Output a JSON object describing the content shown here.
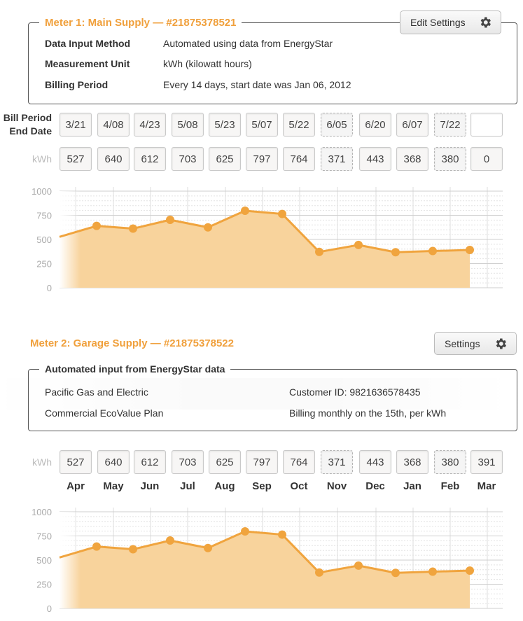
{
  "meter1": {
    "title": "Meter 1: Main Supply — #21875378521",
    "edit_label": "Edit Settings",
    "rows": [
      {
        "label": "Data Input Method",
        "value": "Automated using data from EnergyStar"
      },
      {
        "label": "Measurement Unit",
        "value": "kWh (kilowatt hours)"
      },
      {
        "label": "Billing Period",
        "value": "Every 14 days, start date was Jan 06, 2012"
      }
    ],
    "period_label_line1": "Bill Period",
    "period_label_line2": "End Date",
    "dates": [
      "3/21",
      "4/08",
      "4/23",
      "5/08",
      "5/23",
      "5/07",
      "5/22",
      "6/05",
      "6/20",
      "6/07",
      "7/22",
      ""
    ],
    "kwh_label": "kWh",
    "kwh": [
      "527",
      "640",
      "612",
      "703",
      "625",
      "797",
      "764",
      "371",
      "443",
      "368",
      "380",
      "0"
    ],
    "dashed": [
      7,
      10
    ]
  },
  "meter2": {
    "title": "Meter 2: Garage Supply — #21875378522",
    "settings_label": "Settings",
    "panel_title": "Automated input from EnergyStar data",
    "provider": "Pacific Gas and Electric",
    "plan": "Commercial EcoValue Plan",
    "customer_id": "Customer ID: 9821636578435",
    "billing": "Billing monthly on the 15th, per kWh",
    "kwh_label": "kWh",
    "kwh": [
      "527",
      "640",
      "612",
      "703",
      "625",
      "797",
      "764",
      "371",
      "443",
      "368",
      "380",
      "391"
    ],
    "months": [
      "Apr",
      "May",
      "Jun",
      "Jul",
      "Aug",
      "Sep",
      "Oct",
      "Nov",
      "Dec",
      "Jan",
      "Feb",
      "Mar"
    ],
    "dashed": [
      7,
      10
    ]
  },
  "colors": {
    "accent": "#f0a03c",
    "area_fill": "#f8d39c",
    "line": "#f0a43e"
  },
  "chart_data": [
    {
      "type": "area",
      "x": [
        "3/21",
        "4/08",
        "4/23",
        "5/08",
        "5/23",
        "5/07",
        "5/22",
        "6/05",
        "6/20",
        "6/07",
        "7/22"
      ],
      "series": [
        {
          "values": [
            640,
            612,
            703,
            625,
            797,
            764,
            371,
            443,
            368,
            380,
            391
          ]
        }
      ],
      "lead_in_value": 527,
      "yticks": [
        0,
        250,
        500,
        750,
        1000
      ],
      "ylim": [
        0,
        1000
      ],
      "grid": true
    },
    {
      "type": "area",
      "x": [
        "Apr",
        "May",
        "Jun",
        "Jul",
        "Aug",
        "Sep",
        "Oct",
        "Nov",
        "Dec",
        "Jan",
        "Feb"
      ],
      "series": [
        {
          "values": [
            640,
            612,
            703,
            625,
            797,
            764,
            371,
            443,
            368,
            380,
            391
          ]
        }
      ],
      "lead_in_value": 527,
      "yticks": [
        0,
        250,
        500,
        750,
        1000
      ],
      "ylim": [
        0,
        1000
      ],
      "grid": true
    }
  ]
}
